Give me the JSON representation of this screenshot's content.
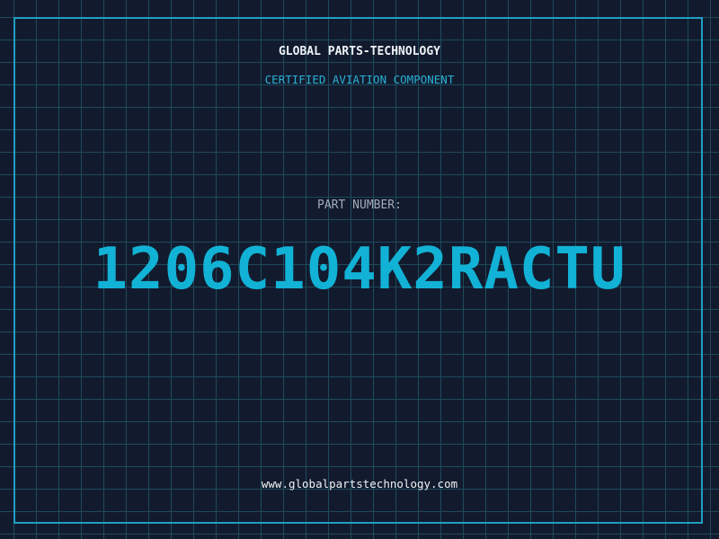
{
  "header": {
    "company": "GLOBAL PARTS-TECHNOLOGY",
    "subtitle": "CERTIFIED AVIATION COMPONENT"
  },
  "main": {
    "label": "PART NUMBER:",
    "part_number": "1206C104K2RACTU"
  },
  "footer": {
    "website": "www.globalpartstechnology.com"
  },
  "colors": {
    "background": "#121b2e",
    "grid": "#1e4a5c",
    "frame": "#1f9fc4",
    "accent": "#12b2d6"
  }
}
